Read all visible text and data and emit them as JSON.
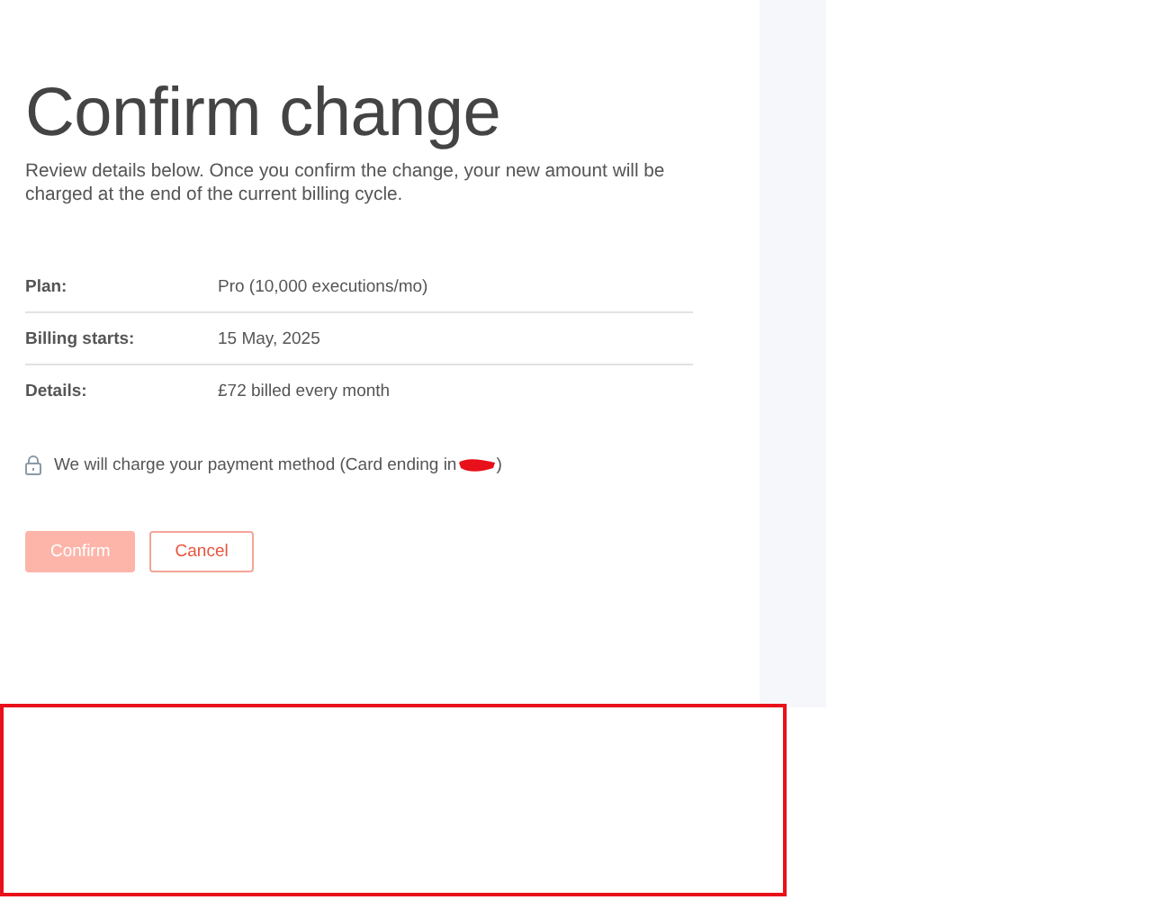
{
  "title": "Confirm change",
  "description": "Review details below. Once you confirm the change, your new amount will be charged at the end of the current billing cycle.",
  "details": [
    {
      "label": "Plan:",
      "value": "Pro (10,000 executions/mo)"
    },
    {
      "label": "Billing starts:",
      "value": "15 May, 2025"
    },
    {
      "label": "Details:",
      "value": "£72 billed every month"
    }
  ],
  "payment_note": {
    "text": "We will charge your payment method (Card ending in",
    "closing": ")"
  },
  "buttons": [
    {
      "label": "Confirm",
      "kind": "primary",
      "disabled": true
    },
    {
      "label": "Cancel",
      "kind": "secondary",
      "disabled": false
    }
  ]
}
